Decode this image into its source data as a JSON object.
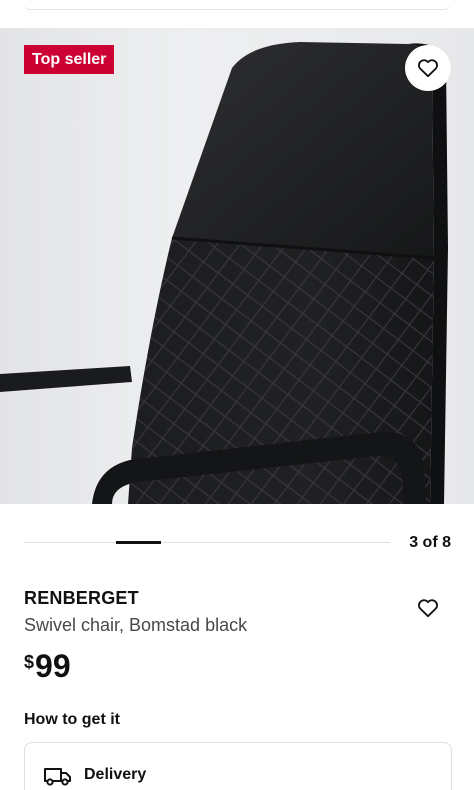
{
  "badge": {
    "label": "Top seller",
    "color": "#cc0033"
  },
  "gallery": {
    "current_image": 3,
    "total_images": 8,
    "counter_text": "3 of 8",
    "image_subject": "Black office chair backrest close-up"
  },
  "product": {
    "name": "RENBERGET",
    "description": "Swivel chair, Bomstad black",
    "price_currency": "$",
    "price_amount": "99"
  },
  "availability": {
    "heading": "How to get it",
    "options": [
      {
        "label": "Delivery",
        "icon": "delivery-truck-icon"
      }
    ]
  },
  "icons": {
    "favorite": "heart-outline-icon",
    "wishlist": "heart-outline-icon"
  }
}
